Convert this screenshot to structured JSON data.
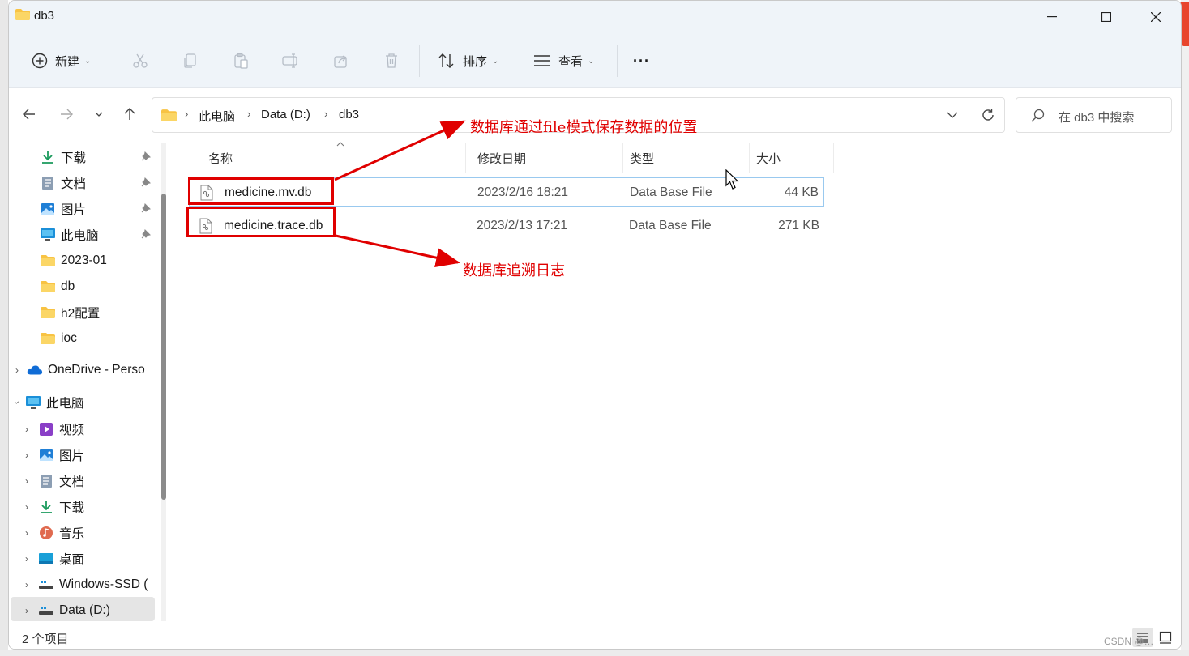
{
  "window": {
    "title": "db3"
  },
  "toolbar": {
    "new_label": "新建",
    "sort_label": "排序",
    "view_label": "查看",
    "more_label": "···"
  },
  "address": {
    "crumbs": [
      "此电脑",
      "Data (D:)",
      "db3"
    ],
    "search_placeholder": "在 db3 中搜索"
  },
  "nav": {
    "quick": [
      {
        "label": "下载",
        "icon": "download-icon",
        "pinned": true
      },
      {
        "label": "文档",
        "icon": "document-icon",
        "pinned": true
      },
      {
        "label": "图片",
        "icon": "picture-icon",
        "pinned": true
      },
      {
        "label": "此电脑",
        "icon": "computer-icon",
        "pinned": true
      },
      {
        "label": "2023-01",
        "icon": "folder-icon",
        "pinned": false
      },
      {
        "label": "db",
        "icon": "folder-icon",
        "pinned": false
      },
      {
        "label": "h2配置",
        "icon": "folder-icon",
        "pinned": false
      },
      {
        "label": "ioc",
        "icon": "folder-icon",
        "pinned": false
      }
    ],
    "onedrive": "OneDrive - Perso",
    "this_pc": "此电脑",
    "pc_items": [
      {
        "label": "视频",
        "icon": "video-icon"
      },
      {
        "label": "图片",
        "icon": "picture-icon"
      },
      {
        "label": "文档",
        "icon": "document-icon"
      },
      {
        "label": "下载",
        "icon": "download-icon"
      },
      {
        "label": "音乐",
        "icon": "music-icon"
      },
      {
        "label": "桌面",
        "icon": "desktop-icon"
      },
      {
        "label": "Windows-SSD (",
        "icon": "drive-icon"
      },
      {
        "label": "Data (D:)",
        "icon": "drive-icon"
      }
    ]
  },
  "columns": {
    "name": "名称",
    "date": "修改日期",
    "type": "类型",
    "size": "大小"
  },
  "files": [
    {
      "name": "medicine.mv.db",
      "date": "2023/2/16 18:21",
      "type": "Data Base File",
      "size": "44 KB"
    },
    {
      "name": "medicine.trace.db",
      "date": "2023/2/13 17:21",
      "type": "Data Base File",
      "size": "271 KB"
    }
  ],
  "status": {
    "count": "2 个项目"
  },
  "annotations": {
    "first": "数据库通过file模式保存数据的位置",
    "second": "数据库追溯日志",
    "color": "#e00000"
  },
  "watermark": "CSDN @…"
}
